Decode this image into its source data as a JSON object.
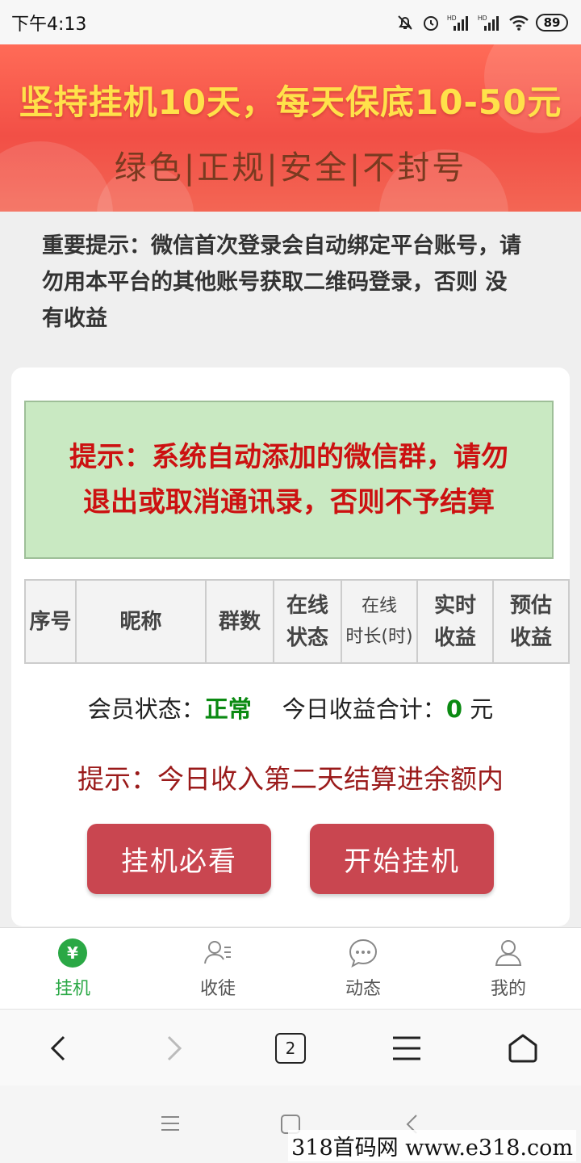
{
  "status_bar": {
    "time": "下午4:13",
    "battery": "89"
  },
  "banner": {
    "line1": "坚持挂机10天，每天保底10-50元",
    "line2": "绿色|正规|安全|不封号"
  },
  "notice": "重要提示：微信首次登录会自动绑定平台账号，请勿用本平台的其他账号获取二维码登录，否则 没有收益",
  "card": {
    "tip_box": {
      "line1": "提示：系统自动添加的微信群，请勿",
      "line2": "退出或取消通讯录，否则不予结算"
    },
    "table_headers": [
      {
        "line1": "序号"
      },
      {
        "line1": "昵称"
      },
      {
        "line1": "群数"
      },
      {
        "line1": "在线",
        "line2": "状态"
      },
      {
        "line1": "在线",
        "line2": "时长(时)"
      },
      {
        "line1": "实时",
        "line2": "收益"
      },
      {
        "line1": "预估",
        "line2": "收益"
      }
    ],
    "member_status_label": "会员状态：",
    "member_status_value": "正常",
    "today_income_label": "今日收益合计：",
    "today_income_value": "0",
    "today_income_unit": "元",
    "income_tip": "提示：今日收入第二天结算进余额内",
    "buttons": {
      "must_read": "挂机必看",
      "start": "开始挂机"
    }
  },
  "tabs": [
    {
      "label": "挂机",
      "icon": "yuan-icon",
      "active": true
    },
    {
      "label": "收徒",
      "icon": "user-list-icon"
    },
    {
      "label": "动态",
      "icon": "chat-bubble-icon"
    },
    {
      "label": "我的",
      "icon": "user-icon"
    }
  ],
  "browser": {
    "tab_count": "2"
  },
  "watermark": "318首码网  www.e318.com",
  "colors": {
    "accent_green": "#2aa845",
    "button_red": "#c94650",
    "tip_red": "#cc1111",
    "status_green": "#0b8a12"
  }
}
